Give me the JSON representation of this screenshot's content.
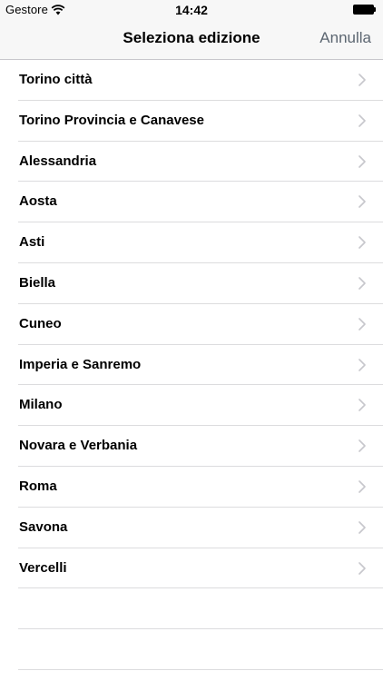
{
  "status_bar": {
    "carrier": "Gestore",
    "time": "14:42",
    "wifi_icon": "wifi-icon",
    "battery_icon": "battery-icon"
  },
  "nav": {
    "title": "Seleziona edizione",
    "cancel_label": "Annulla"
  },
  "editions": [
    {
      "label": "Torino città"
    },
    {
      "label": "Torino Provincia e Canavese"
    },
    {
      "label": "Alessandria"
    },
    {
      "label": "Aosta"
    },
    {
      "label": "Asti"
    },
    {
      "label": "Biella"
    },
    {
      "label": "Cuneo"
    },
    {
      "label": "Imperia e Sanremo"
    },
    {
      "label": "Milano"
    },
    {
      "label": "Novara e Verbania"
    },
    {
      "label": "Roma"
    },
    {
      "label": "Savona"
    },
    {
      "label": "Vercelli"
    }
  ],
  "row_icon": "chevron-right-icon",
  "colors": {
    "nav_background": "#f7f7f7",
    "cancel_text": "#5c6671",
    "separator": "#dcdcde",
    "chevron": "#c7c7cc"
  }
}
